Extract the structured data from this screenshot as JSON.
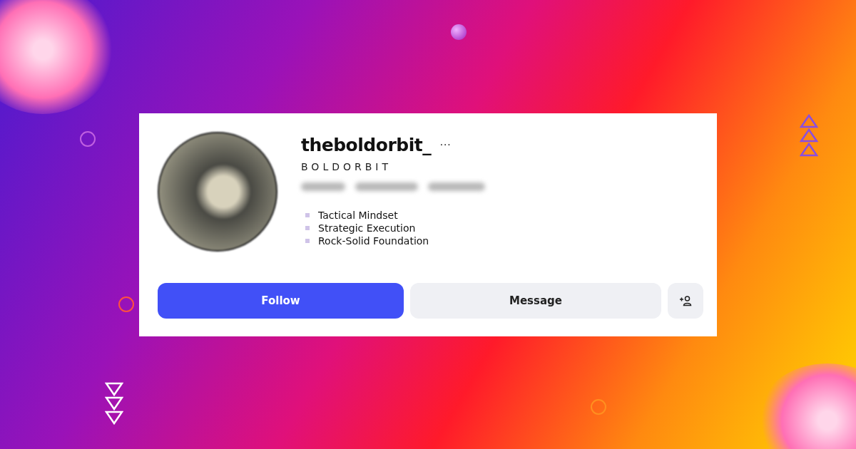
{
  "profile": {
    "username": "theboldorbit_",
    "more": "···",
    "display_name": "BOLDORBIT",
    "bio": [
      "Tactical Mindset",
      "Strategic Execution",
      "Rock-Solid Foundation"
    ]
  },
  "buttons": [
    {
      "kind": "primary",
      "label": "Follow"
    },
    {
      "kind": "secondary",
      "label": "Message"
    },
    {
      "kind": "icon"
    }
  ]
}
